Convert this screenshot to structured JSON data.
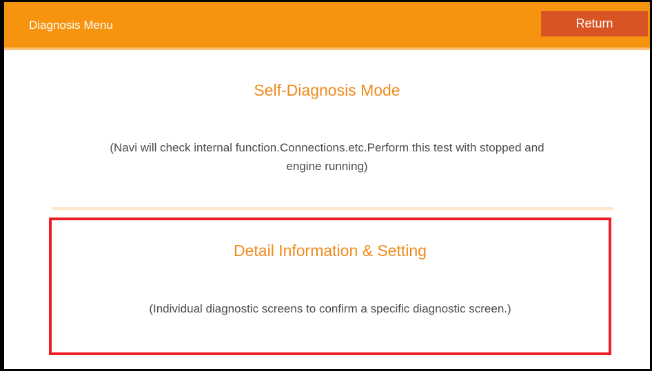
{
  "header": {
    "title": "Diagnosis Menu",
    "return_label": "Return"
  },
  "menu": {
    "options": [
      {
        "title": "Self-Diagnosis Mode",
        "description": "(Navi will check internal function.Connections.etc.Perform this test with stopped and engine running)"
      },
      {
        "title": "Detail Information & Setting",
        "description": "(Individual diagnostic screens to confirm a specific diagnostic screen.)",
        "highlighted": true
      }
    ]
  },
  "colors": {
    "header_bg": "#f7940f",
    "return_button_bg": "#d95424",
    "option_title": "#f08a1a",
    "highlight_border": "#ee1c24"
  }
}
